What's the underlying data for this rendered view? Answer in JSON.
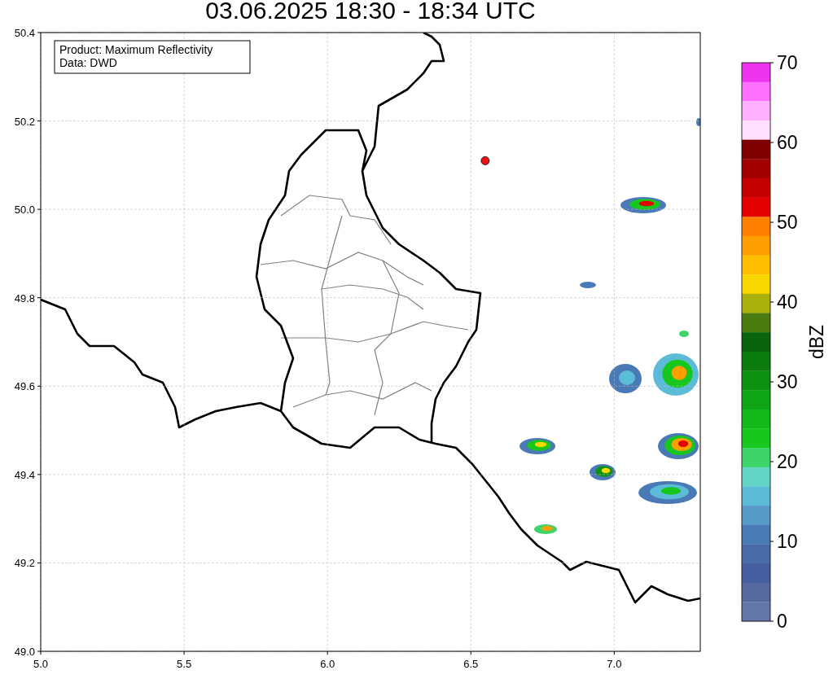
{
  "chart_data": {
    "type": "scatter",
    "title": "03.06.2025 18:30 - 18:34 UTC",
    "grid": true,
    "xlim": [
      5.0,
      7.3
    ],
    "ylim": [
      49.0,
      50.4
    ],
    "xticks": [
      {
        "value": 5.0,
        "label": "5.0"
      },
      {
        "value": 5.5,
        "label": "5.5"
      },
      {
        "value": 6.0,
        "label": "6.0"
      },
      {
        "value": 6.5,
        "label": "6.5"
      },
      {
        "value": 7.0,
        "label": "7.0"
      }
    ],
    "yticks": [
      {
        "value": 49.0,
        "label": "49.0"
      },
      {
        "value": 49.2,
        "label": "49.2"
      },
      {
        "value": 49.4,
        "label": "49.4"
      },
      {
        "value": 49.6,
        "label": "49.6"
      },
      {
        "value": 49.8,
        "label": "49.8"
      },
      {
        "value": 50.0,
        "label": "50.0"
      },
      {
        "value": 50.2,
        "label": "50.2"
      },
      {
        "value": 50.4,
        "label": "50.4"
      }
    ],
    "x": [
      6.55
    ],
    "series": [
      {
        "color": "#ee1111",
        "values": [
          50.11
        ]
      }
    ]
  },
  "info_box": {
    "lines": [
      "Product: Maximum Reflectivity",
      "Data: DWD"
    ]
  },
  "colorbar": {
    "label": "dBZ",
    "ticks": [
      "70",
      "60",
      "50",
      "40",
      "30",
      "20",
      "10",
      "0"
    ],
    "segments": [
      {
        "color": "#ee33ee"
      },
      {
        "color": "#ff70ff"
      },
      {
        "color": "#ffb0ff"
      },
      {
        "color": "#ffe0ff"
      },
      {
        "color": "#7f0000"
      },
      {
        "color": "#a20000"
      },
      {
        "color": "#c40000"
      },
      {
        "color": "#e30000"
      },
      {
        "color": "#ff7f00"
      },
      {
        "color": "#ff9e00"
      },
      {
        "color": "#ffbe00"
      },
      {
        "color": "#f8d800"
      },
      {
        "color": "#aab00c"
      },
      {
        "color": "#4a7a10"
      },
      {
        "color": "#0a640d"
      },
      {
        "color": "#0c7b10"
      },
      {
        "color": "#0e9013"
      },
      {
        "color": "#10a516"
      },
      {
        "color": "#12b81a"
      },
      {
        "color": "#17c71d"
      },
      {
        "color": "#3ed46a"
      },
      {
        "color": "#63d5c5"
      },
      {
        "color": "#5cbcd8"
      },
      {
        "color": "#589ac8"
      },
      {
        "color": "#4a7ab6"
      },
      {
        "color": "#4a6aa8"
      },
      {
        "color": "#465da0"
      },
      {
        "color": "#56699f"
      },
      {
        "color": "#6476a8"
      }
    ]
  }
}
